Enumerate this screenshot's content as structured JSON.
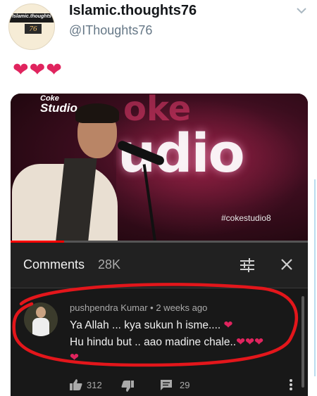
{
  "account": {
    "display_name": "Islamic.thoughts76",
    "username": "@IThoughts76",
    "avatar_text": "Islamic.thoughts",
    "avatar_number": "76"
  },
  "tweet": {
    "hearts": "❤❤❤"
  },
  "video": {
    "logo_line1": "Coke",
    "logo_line2": "Studio",
    "hashtag": "#cokestudio8",
    "progress": 0.18
  },
  "comments_panel": {
    "title": "Comments",
    "count": "28K"
  },
  "comment": {
    "meta": "pushpendra Kumar • 2 weeks ago",
    "line1": "Ya Allah ... kya sukun h isme....",
    "line1_heart": "❤",
    "line2": "Hu hindu but .. aao madine chale..",
    "line2_hearts": "❤❤❤",
    "line3_heart": "❤",
    "likes": "312",
    "replies": "29"
  },
  "colors": {
    "heart": "#e0245e",
    "annotation_red": "#e3161b",
    "panel_dark": "#212121",
    "progress_red": "#ff0000"
  }
}
